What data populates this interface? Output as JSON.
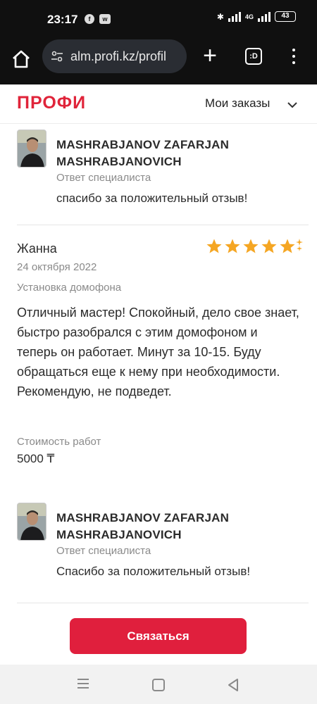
{
  "status_bar": {
    "time": "23:17",
    "network": "4G",
    "battery": "43"
  },
  "browser": {
    "url": "alm.profi.kz/profil",
    "tabs_label": ":D"
  },
  "header": {
    "logo": "ПРОФИ",
    "orders": "Мои заказы"
  },
  "replies": [
    {
      "name_line1": "MASHRABJANOV ZAFARJAN",
      "name_line2": "MASHRABJANOVICH",
      "role": "Ответ специалиста",
      "text": "спасибо за положительный отзыв!"
    },
    {
      "name_line1": "MASHRABJANOV ZAFARJAN",
      "name_line2": "MASHRABJANOVICH",
      "role": "Ответ специалиста",
      "text": "Спасибо за положительный отзыв!"
    }
  ],
  "review": {
    "author": "Жанна",
    "rating": 5,
    "date": "24 октября 2022",
    "service": "Установка домофона",
    "text": "Отличный мастер! Спокойный, дело свое знает, быстро разобрался с этим домофоном и теперь он работает. Минут за 10-15. Буду обращаться еще к нему при необходимости. Рекомендую, не подведет.",
    "cost_label": "Стоимость работ",
    "cost_value": "5000 ₸"
  },
  "cta": {
    "label": "Связаться"
  },
  "colors": {
    "brand_red": "#e01f3d",
    "star": "#f5a623"
  }
}
